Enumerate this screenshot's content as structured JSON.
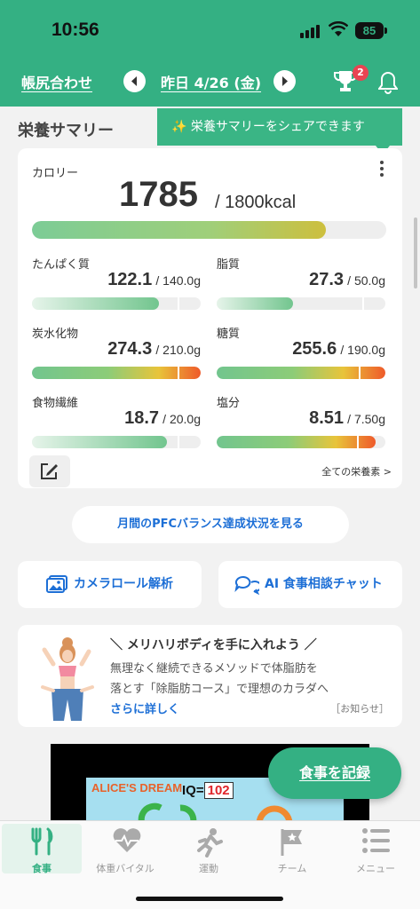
{
  "status_bar": {
    "time": "10:56",
    "battery": "85"
  },
  "header": {
    "left_link": "帳尻合わせ",
    "date": "昨日 4/26 (金)",
    "trophy_badge": "2"
  },
  "summary": {
    "title": "栄養サマリー",
    "tooltip": "✨ 栄養サマリーをシェアできます",
    "calorie": {
      "label": "カロリー",
      "value": "1785",
      "target": "/ 1800kcal",
      "progress": 0.99
    },
    "nutrients": [
      {
        "label": "たんぱく質",
        "value": "122.1",
        "target": "/ 140.0g",
        "progress": 0.87,
        "over": false
      },
      {
        "label": "脂質",
        "value": "27.3",
        "target": "/ 50.0g",
        "progress": 0.55,
        "over": false
      },
      {
        "label": "炭水化物",
        "value": "274.3",
        "target": "/ 210.0g",
        "progress": 1.3,
        "over": true
      },
      {
        "label": "糖質",
        "value": "255.6",
        "target": "/ 190.0g",
        "progress": 1.35,
        "over": true
      },
      {
        "label": "食物繊維",
        "value": "18.7",
        "target": "/ 20.0g",
        "progress": 0.94,
        "over": false
      },
      {
        "label": "塩分",
        "value": "8.51",
        "target": "/ 7.50g",
        "progress": 1.13,
        "over": true
      }
    ],
    "all_nutrients_link": "全ての栄養素 >"
  },
  "pfc_button": "月間のPFCバランス達成状況を見る",
  "actions": {
    "camera_roll": "カメラロール解析",
    "ai_chat": "AI 食事相談チャット"
  },
  "promo": {
    "title": "＼ メリハリボディを手に入れよう ／",
    "line1": "無理なく継続できるメソッドで体脂肪を",
    "line2": "落とす「除脂肪コース」で理想のカラダへ",
    "more": "さらに詳しく",
    "tag": "［お知らせ］"
  },
  "ad": {
    "logo": "ALICE'S DREAM",
    "iq_label": "IQ=",
    "iq_value": "102"
  },
  "fab": "食事を記録",
  "tabs": [
    {
      "label": "食事",
      "icon": "fork-knife-icon",
      "active": true
    },
    {
      "label": "体重バイタル",
      "icon": "heart-monitor-icon",
      "active": false
    },
    {
      "label": "運動",
      "icon": "running-icon",
      "active": false
    },
    {
      "label": "チーム",
      "icon": "flag-icon",
      "active": false
    },
    {
      "label": "メニュー",
      "icon": "menu-icon",
      "active": false
    }
  ],
  "colors": {
    "brand": "#34b083",
    "link": "#1d6fd6",
    "badge": "#e94452"
  }
}
